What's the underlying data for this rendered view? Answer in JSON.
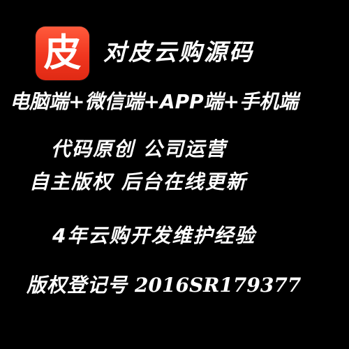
{
  "logo": {
    "glyph": "皮",
    "background_color": "#f1361f"
  },
  "brand": {
    "name": "对皮云购源码"
  },
  "features": {
    "platforms": "电脑端+微信端+APP端+手机端",
    "original": "代码原创 公司运营",
    "copyright_update": "自主版权 后台在线更新",
    "experience": "4年云购开发维护经验",
    "registration_label": "版权登记号",
    "registration_number": "2016SR179377"
  }
}
